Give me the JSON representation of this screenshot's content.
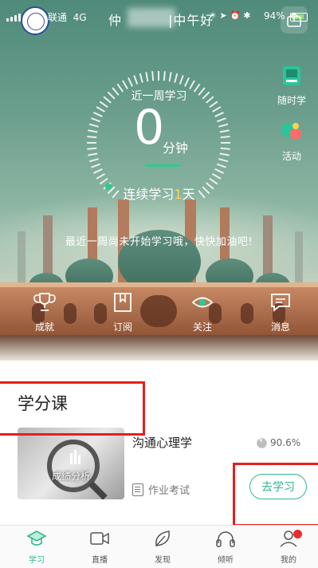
{
  "status_bar": {
    "carrier": "联通",
    "network": "4G",
    "greeting": "仲",
    "greeting_suffix": "中午好",
    "battery_percent": "94%"
  },
  "summary": {
    "title": "近一周学习",
    "minutes": "0",
    "unit": "分钟",
    "streak_prefix": "连续学习",
    "streak_days": "1",
    "streak_suffix": "天",
    "motivation": "最近一周尚未开始学习哦，快快加油吧!"
  },
  "side_shortcuts": [
    {
      "label": "随时学",
      "icon": "book-icon"
    },
    {
      "label": "活动",
      "icon": "activity-icon"
    }
  ],
  "actions": [
    {
      "label": "成就",
      "icon": "trophy-icon"
    },
    {
      "label": "订阅",
      "icon": "bookmark-icon"
    },
    {
      "label": "关注",
      "icon": "eye-icon"
    },
    {
      "label": "消息",
      "icon": "message-icon"
    }
  ],
  "section": {
    "title": "学分课"
  },
  "course": {
    "thumb_caption": "成绩分析",
    "name": "沟通心理学",
    "progress": "90.6%",
    "progress_value": 0.906,
    "exam_label": "作业考试",
    "action_label": "去学习"
  },
  "tabbar": {
    "items": [
      {
        "label": "学习",
        "icon": "graduation-cap-icon",
        "active": true
      },
      {
        "label": "直播",
        "icon": "video-camera-icon",
        "active": false
      },
      {
        "label": "发现",
        "icon": "leaf-icon",
        "active": false
      },
      {
        "label": "倾听",
        "icon": "headphones-icon",
        "active": false
      },
      {
        "label": "我的",
        "icon": "user-icon",
        "active": false
      }
    ]
  },
  "colors": {
    "accent": "#2fb98a",
    "highlight_red": "#e51f1f",
    "streak_number": "#ffd54a"
  }
}
